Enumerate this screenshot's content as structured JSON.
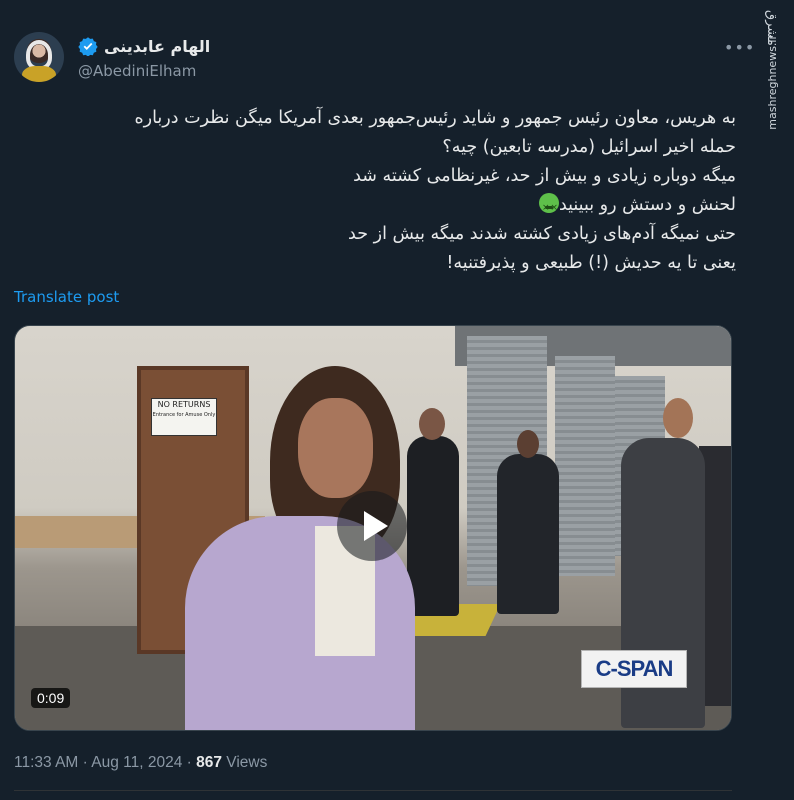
{
  "author": {
    "display_name": "الهام عابدینی",
    "handle": "@AbediniElham",
    "verified": true
  },
  "watermark": {
    "logo_text": "مشرق",
    "url": "mashreghnews.ir"
  },
  "tweet": {
    "lines": [
      "به هریس، معاون رئیس جمهور و شاید رئیس‌جمهور بعدی آمریکا میگن نظرت درباره",
      "حمله اخیر اسرائیل (مدرسه تابعین) چیه؟",
      "میگه دوباره زیادی و بیش از حد، غیرنظامی کشته شد",
      "لحنش و دستش رو ببینید",
      "حتی نمیگه آدم‌های زیادی کشته شدند میگه بیش از حد",
      "یعنی تا یه حدیش (!) طبیعی و پذیرفتنیه!"
    ],
    "emoji": "nauseated-face"
  },
  "translate_link": "Translate post",
  "video": {
    "duration": "0:09",
    "overlay_logo": "C-SPAN",
    "sign_title": "NO RETURNS",
    "sign_subtitle": "Entrance for Amuse Only"
  },
  "meta": {
    "time": "11:33 AM",
    "separator1": " · ",
    "date": "Aug 11, 2024",
    "separator2": " · ",
    "views_count": "867",
    "views_label": " Views"
  },
  "colors": {
    "background": "#15202b",
    "link": "#1d9bf0",
    "verified": "#1d9bf0",
    "secondary_text": "#8b98a5"
  }
}
